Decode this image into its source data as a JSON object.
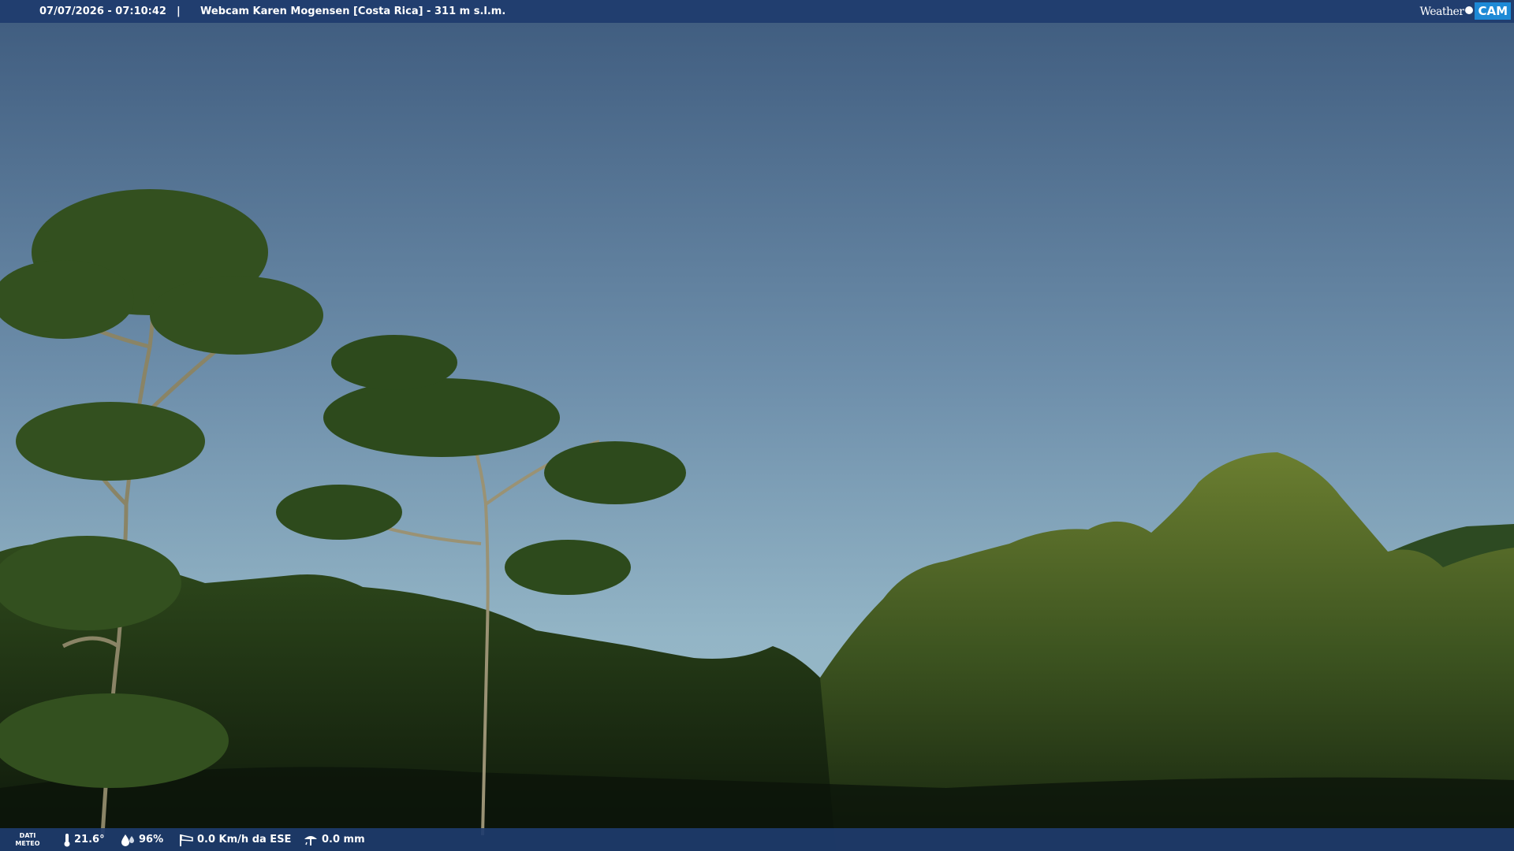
{
  "overlay": {
    "datetime": "07/07/2026 - 07:10:42",
    "separator": "|",
    "title": "Webcam Karen Mogensen [Costa Rica]  - 311 m s.l.m.",
    "logo": {
      "word": "Weather",
      "badge": "CAM"
    },
    "accent_color": "#1e3c6e",
    "logo_badge_color": "#1e8ad6"
  },
  "weather": {
    "label_line1": "DATI",
    "label_line2": "METEO",
    "temperature": "21.6°",
    "humidity": "96%",
    "wind": "0.0 Km/h da ESE",
    "rain": "0.0 mm",
    "icons": [
      "thermometer-icon",
      "humidity-drops-icon",
      "wind-sock-icon",
      "rain-gauge-icon"
    ]
  },
  "scene": {
    "description_colors": {
      "sky_top": "#3f5d80",
      "sky_horizon": "#8fb2c4",
      "foliage_dark": "#16240f",
      "foliage_lit": "#5a7a2a"
    }
  }
}
